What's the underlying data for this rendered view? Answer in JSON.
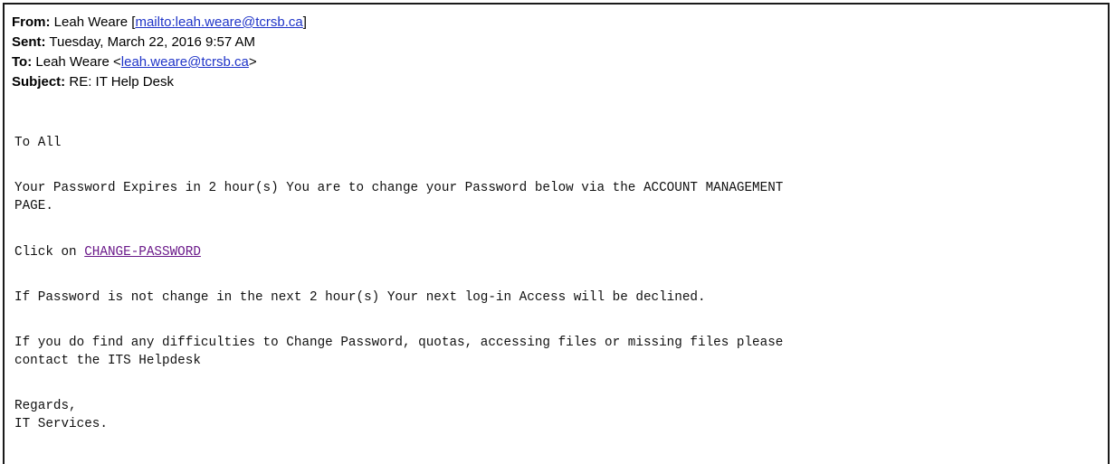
{
  "header": {
    "from_label": "From:",
    "from_name": " Leah Weare [",
    "from_link": "mailto:leah.weare@tcrsb.ca",
    "from_close": "]",
    "sent_label": "Sent:",
    "sent_value": " Tuesday, March 22, 2016 9:57 AM",
    "to_label": "To:",
    "to_name": " Leah Weare <",
    "to_link": "leah.weare@tcrsb.ca",
    "to_close": ">",
    "subject_label": "Subject:",
    "subject_value": " RE: IT Help Desk"
  },
  "body": {
    "greeting": "To All",
    "para1_line1": "Your Password Expires in 2 hour(s) You are to change your Password below via the ACCOUNT MANAGEMENT",
    "para1_line2": "PAGE.",
    "click_prefix": "Click on ",
    "click_link": "CHANGE-PASSWORD",
    "para2": "If Password is not change in the next 2 hour(s) Your next log-in Access will be declined.",
    "para3_line1": "If you do find any difficulties to Change Password, quotas, accessing files or missing files please",
    "para3_line2": "contact the ITS Helpdesk",
    "closing": "Regards,",
    "signature": "IT Services."
  },
  "colors": {
    "header_link": "#1f34c8",
    "body_link": "#6b1a8a",
    "border": "#1a1a1a"
  }
}
